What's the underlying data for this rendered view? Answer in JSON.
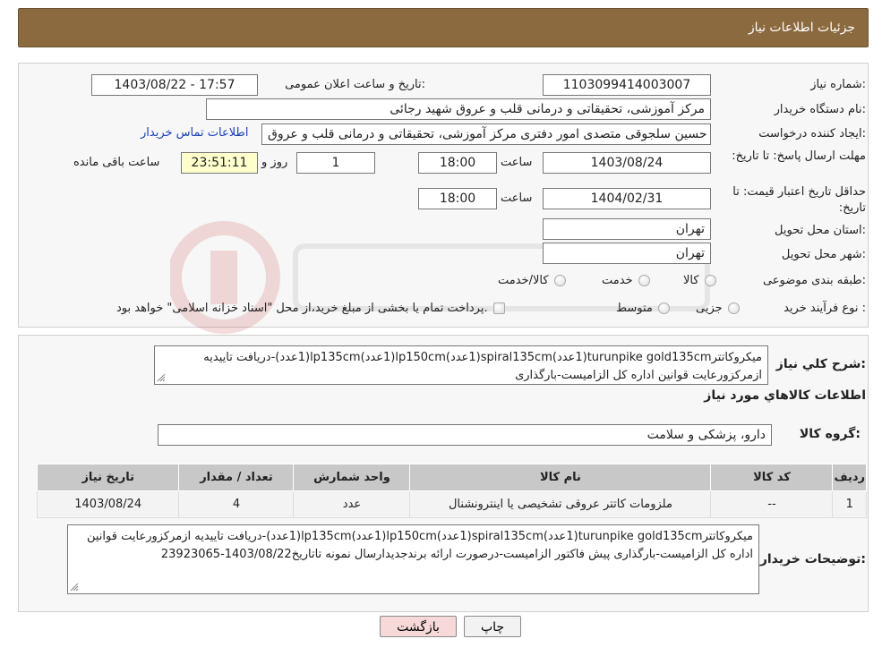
{
  "header": {
    "title": "جزئیات اطلاعات نیاز"
  },
  "form": {
    "need_number_label": "شماره نیاز:",
    "need_number": "1103099414003007",
    "announce_label": "تاریخ و ساعت اعلان عمومی:",
    "announce_value": "1403/08/22 - 17:57",
    "buyer_org_label": "نام دستگاه خریدار:",
    "buyer_org": "مرکز آموزشی، تحقیقاتی و درمانی قلب و عروق شهید رجائی",
    "creator_label": "ایجاد کننده درخواست:",
    "creator": "حسین سلجوقی متصدی امور دفتری مرکز آموزشی، تحقیقاتی و درمانی قلب و عروق",
    "contact_link": "اطلاعات تماس خریدار",
    "deadline_label": "مهلت ارسال پاسخ: تا تاریخ:",
    "deadline_date": "1403/08/24",
    "time_label": "ساعت",
    "deadline_time": "18:00",
    "days_value": "1",
    "days_label": "روز و",
    "remaining_time": "23:51:11",
    "remaining_label": "ساعت باقی مانده",
    "validity_label": "حداقل تاریخ اعتبار قیمت: تا تاریخ:",
    "validity_date": "1404/02/31",
    "validity_time": "18:00",
    "province_label": "استان محل تحویل:",
    "province": "تهران",
    "city_label": "شهر محل تحویل:",
    "city": "تهران",
    "category_label": "طبقه بندی موضوعی:",
    "category_options": [
      "کالا",
      "خدمت",
      "کالا/خدمت"
    ],
    "process_label": "نوع فرآیند خرید :",
    "process_options": [
      "جزیی",
      "متوسط"
    ],
    "process_note": "پرداخت تمام یا بخشی از مبلغ خرید،از محل \"اسناد خزانه اسلامی\" خواهد بود."
  },
  "summary": {
    "desc_label": "شرح کلي نیاز:",
    "desc_text": "میکروکاتترturunpike gold135cm(1عدد)spiral135cm(1عدد)lp150cm(1عدد)lp135cm(1عدد)-دریافت تاییدیه ازمرکزورعایت قوانین اداره کل الزامیست-بارگذاری",
    "goods_info_title": "اطلاعات کالاهاي مورد نیاز",
    "goods_group_label": "گروه کالا:",
    "goods_group": "دارو، پزشکی و سلامت"
  },
  "table": {
    "headers": [
      "ردیف",
      "کد کالا",
      "نام کالا",
      "واحد شمارش",
      "تعداد / مقدار",
      "تاریخ نیاز"
    ],
    "rows": [
      [
        "1",
        "--",
        "ملزومات کاتتر عروقی تشخیصی یا اینترونشنال",
        "عدد",
        "4",
        "1403/08/24"
      ]
    ]
  },
  "buyer_notes": {
    "label": "توضیحات خریدار:",
    "text": "میکروکاتترturunpike gold135cm(1عدد)spiral135cm(1عدد)lp150cm(1عدد)lp135cm(1عدد)-دریافت تاییدیه ازمرکزورعایت قوانین اداره کل الزامیست-بارگذاری پیش فاکتور الزامیست-درصورت ارائه برندجدیدارسال نمونه تاتاریخ1403/08/22-23923065"
  },
  "buttons": {
    "print": "چاپ",
    "back": "بازگشت"
  },
  "colors": {
    "header": "#8b6a3f",
    "back_button": "#f7d9d9",
    "remaining_bg": "#ffffcc",
    "link": "#1a3fb5"
  }
}
